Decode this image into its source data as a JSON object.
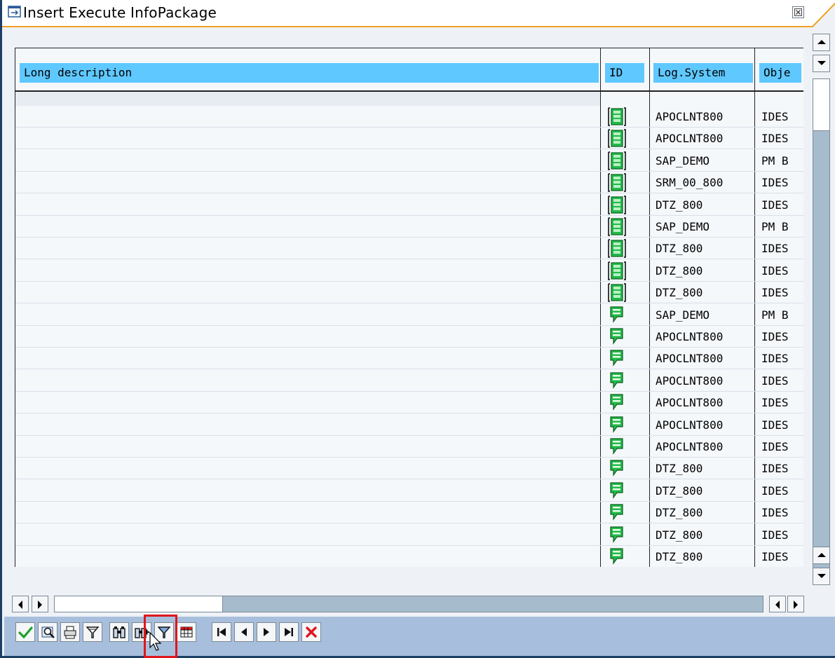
{
  "window": {
    "title": "Insert Execute InfoPackage"
  },
  "icons": {
    "window_icon": "window-icon",
    "close": "close-icon",
    "row_status_framed": "green-box-icon",
    "row_status_plain": "green-flag-icon"
  },
  "table": {
    "columns": [
      "Long description",
      "ID",
      "Log.System",
      "Obje"
    ],
    "rows": [
      {
        "long_description": "",
        "id_icon": "framed",
        "log_system": "APOCLNT800",
        "object": "IDES"
      },
      {
        "long_description": "",
        "id_icon": "framed",
        "log_system": "APOCLNT800",
        "object": "IDES"
      },
      {
        "long_description": "",
        "id_icon": "framed",
        "log_system": "SAP_DEMO",
        "object": "PM B"
      },
      {
        "long_description": "",
        "id_icon": "framed",
        "log_system": "SRM_00_800",
        "object": "IDES"
      },
      {
        "long_description": "",
        "id_icon": "framed",
        "log_system": "DTZ_800",
        "object": "IDES"
      },
      {
        "long_description": "",
        "id_icon": "framed",
        "log_system": "SAP_DEMO",
        "object": "PM B"
      },
      {
        "long_description": "",
        "id_icon": "framed",
        "log_system": "DTZ_800",
        "object": "IDES"
      },
      {
        "long_description": "",
        "id_icon": "framed",
        "log_system": "DTZ_800",
        "object": "IDES"
      },
      {
        "long_description": "",
        "id_icon": "framed",
        "log_system": "DTZ_800",
        "object": "IDES"
      },
      {
        "long_description": "",
        "id_icon": "plain",
        "log_system": "SAP_DEMO",
        "object": "PM B"
      },
      {
        "long_description": "",
        "id_icon": "plain",
        "log_system": "APOCLNT800",
        "object": "IDES"
      },
      {
        "long_description": "",
        "id_icon": "plain",
        "log_system": "APOCLNT800",
        "object": "IDES"
      },
      {
        "long_description": "",
        "id_icon": "plain",
        "log_system": "APOCLNT800",
        "object": "IDES"
      },
      {
        "long_description": "",
        "id_icon": "plain",
        "log_system": "APOCLNT800",
        "object": "IDES"
      },
      {
        "long_description": "",
        "id_icon": "plain",
        "log_system": "APOCLNT800",
        "object": "IDES"
      },
      {
        "long_description": "",
        "id_icon": "plain",
        "log_system": "APOCLNT800",
        "object": "IDES"
      },
      {
        "long_description": "",
        "id_icon": "plain",
        "log_system": "DTZ_800",
        "object": "IDES"
      },
      {
        "long_description": "",
        "id_icon": "plain",
        "log_system": "DTZ_800",
        "object": "IDES"
      },
      {
        "long_description": "",
        "id_icon": "plain",
        "log_system": "DTZ_800",
        "object": "IDES"
      },
      {
        "long_description": "",
        "id_icon": "plain",
        "log_system": "DTZ_800",
        "object": "IDES"
      },
      {
        "long_description": "",
        "id_icon": "plain",
        "log_system": "DTZ_800",
        "object": "IDES"
      }
    ]
  },
  "toolbar": {
    "buttons": [
      {
        "name": "continue-button",
        "icon": "checkmark-icon"
      },
      {
        "name": "details-button",
        "icon": "magnifier-details-icon"
      },
      {
        "name": "print-button",
        "icon": "printer-icon"
      },
      {
        "name": "sort-button",
        "icon": "sort-funnel-icon"
      },
      {
        "name": "find-button",
        "icon": "binoculars-icon",
        "highlighted": true
      },
      {
        "name": "find-next-button",
        "icon": "binoculars-plus-icon"
      },
      {
        "name": "filter-button",
        "icon": "filter-icon"
      },
      {
        "name": "layout-button",
        "icon": "grid-layout-icon"
      },
      {
        "name": "first-page-button",
        "icon": "first-page-icon"
      },
      {
        "name": "previous-page-button",
        "icon": "previous-page-icon"
      },
      {
        "name": "next-page-button",
        "icon": "next-page-icon"
      },
      {
        "name": "last-page-button",
        "icon": "last-page-icon"
      },
      {
        "name": "cancel-button",
        "icon": "cancel-x-icon"
      }
    ]
  },
  "scroll": {
    "vertical_position": 0.0,
    "horizontal_position": 0.0
  },
  "colors": {
    "header_cell": "#5fc8ff",
    "title_accent": "#f0a020",
    "toolbar_bg": "#a7bfdc",
    "highlight": "#e0151c",
    "status_green": "#22b94a"
  }
}
